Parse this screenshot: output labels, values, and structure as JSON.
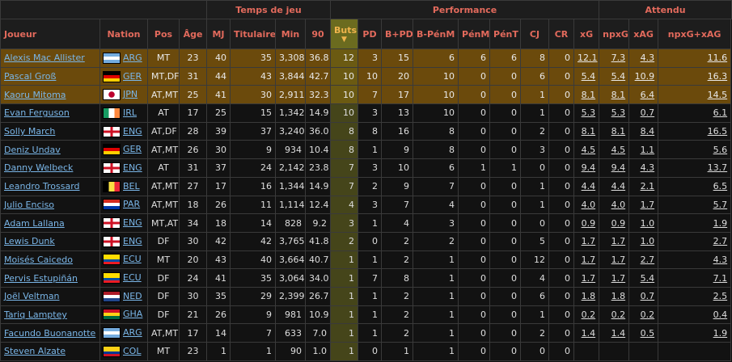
{
  "header": {
    "groups": {
      "playing_time": "Temps de jeu",
      "performance": "Performance",
      "expected": "Attendu"
    },
    "columns": {
      "player": "Joueur",
      "nation": "Nation",
      "pos": "Pos",
      "age": "Âge",
      "mp": "MJ",
      "starts": "Titulaire",
      "min": "Min",
      "nineties": "90",
      "goals": "Buts",
      "sort_arrow": "▼",
      "assists": "PD",
      "ga": "B+PD",
      "gpk": "B-PénM",
      "pk": "PénM",
      "pkatt": "PénT",
      "crdy": "CJ",
      "crdr": "CR",
      "xg": "xG",
      "npxg": "npxG",
      "xag": "xAG",
      "npxgxag": "npxG+xAG"
    }
  },
  "colors": {
    "highlight_row": "#6b4a0c",
    "sorted_column": "#45451a",
    "header_text": "#e26a5c",
    "link": "#7ab6e8"
  },
  "rows": [
    {
      "player": "Alexis Mac Allister",
      "flag": "ARG",
      "nation": "ARG",
      "pos": "MT",
      "age": "23",
      "mp": "40",
      "starts": "35",
      "min": "3,308",
      "nineties": "36.8",
      "goals": "12",
      "assists": "3",
      "ga": "15",
      "gpk": "6",
      "pk": "6",
      "pkatt": "6",
      "crdy": "8",
      "crdr": "0",
      "xg": "12.1",
      "npxg": "7.3",
      "xag": "4.3",
      "npxgxag": "11.6",
      "highlight": true
    },
    {
      "player": "Pascal Groß",
      "flag": "GER",
      "nation": "GER",
      "pos": "MT,DF",
      "age": "31",
      "mp": "44",
      "starts": "43",
      "min": "3,844",
      "nineties": "42.7",
      "goals": "10",
      "assists": "10",
      "ga": "20",
      "gpk": "10",
      "pk": "0",
      "pkatt": "0",
      "crdy": "6",
      "crdr": "0",
      "xg": "5.4",
      "npxg": "5.4",
      "xag": "10.9",
      "npxgxag": "16.3",
      "highlight": true
    },
    {
      "player": "Kaoru Mitoma",
      "flag": "JPN",
      "nation": "JPN",
      "pos": "AT,MT",
      "age": "25",
      "mp": "41",
      "starts": "30",
      "min": "2,911",
      "nineties": "32.3",
      "goals": "10",
      "assists": "7",
      "ga": "17",
      "gpk": "10",
      "pk": "0",
      "pkatt": "0",
      "crdy": "1",
      "crdr": "0",
      "xg": "8.1",
      "npxg": "8.1",
      "xag": "6.4",
      "npxgxag": "14.5",
      "highlight": true
    },
    {
      "player": "Evan Ferguson",
      "flag": "IRL",
      "nation": "IRL",
      "pos": "AT",
      "age": "17",
      "mp": "25",
      "starts": "15",
      "min": "1,342",
      "nineties": "14.9",
      "goals": "10",
      "assists": "3",
      "ga": "13",
      "gpk": "10",
      "pk": "0",
      "pkatt": "0",
      "crdy": "1",
      "crdr": "0",
      "xg": "5.3",
      "npxg": "5.3",
      "xag": "0.7",
      "npxgxag": "6.1",
      "highlight": false
    },
    {
      "player": "Solly March",
      "flag": "ENG",
      "nation": "ENG",
      "pos": "AT,DF",
      "age": "28",
      "mp": "39",
      "starts": "37",
      "min": "3,240",
      "nineties": "36.0",
      "goals": "8",
      "assists": "8",
      "ga": "16",
      "gpk": "8",
      "pk": "0",
      "pkatt": "0",
      "crdy": "2",
      "crdr": "0",
      "xg": "8.1",
      "npxg": "8.1",
      "xag": "8.4",
      "npxgxag": "16.5",
      "highlight": false
    },
    {
      "player": "Deniz Undav",
      "flag": "GER",
      "nation": "GER",
      "pos": "AT,MT",
      "age": "26",
      "mp": "30",
      "starts": "9",
      "min": "934",
      "nineties": "10.4",
      "goals": "8",
      "assists": "1",
      "ga": "9",
      "gpk": "8",
      "pk": "0",
      "pkatt": "0",
      "crdy": "3",
      "crdr": "0",
      "xg": "4.5",
      "npxg": "4.5",
      "xag": "1.1",
      "npxgxag": "5.6",
      "highlight": false
    },
    {
      "player": "Danny Welbeck",
      "flag": "ENG",
      "nation": "ENG",
      "pos": "AT",
      "age": "31",
      "mp": "37",
      "starts": "24",
      "min": "2,142",
      "nineties": "23.8",
      "goals": "7",
      "assists": "3",
      "ga": "10",
      "gpk": "6",
      "pk": "1",
      "pkatt": "1",
      "crdy": "0",
      "crdr": "0",
      "xg": "9.4",
      "npxg": "9.4",
      "xag": "4.3",
      "npxgxag": "13.7",
      "highlight": false
    },
    {
      "player": "Leandro Trossard",
      "flag": "BEL",
      "nation": "BEL",
      "pos": "AT,MT",
      "age": "27",
      "mp": "17",
      "starts": "16",
      "min": "1,344",
      "nineties": "14.9",
      "goals": "7",
      "assists": "2",
      "ga": "9",
      "gpk": "7",
      "pk": "0",
      "pkatt": "0",
      "crdy": "1",
      "crdr": "0",
      "xg": "4.4",
      "npxg": "4.4",
      "xag": "2.1",
      "npxgxag": "6.5",
      "highlight": false
    },
    {
      "player": "Julio Enciso",
      "flag": "PAR",
      "nation": "PAR",
      "pos": "AT,MT",
      "age": "18",
      "mp": "26",
      "starts": "11",
      "min": "1,114",
      "nineties": "12.4",
      "goals": "4",
      "assists": "3",
      "ga": "7",
      "gpk": "4",
      "pk": "0",
      "pkatt": "0",
      "crdy": "1",
      "crdr": "0",
      "xg": "4.0",
      "npxg": "4.0",
      "xag": "1.7",
      "npxgxag": "5.7",
      "highlight": false
    },
    {
      "player": "Adam Lallana",
      "flag": "ENG",
      "nation": "ENG",
      "pos": "MT,AT",
      "age": "34",
      "mp": "18",
      "starts": "14",
      "min": "828",
      "nineties": "9.2",
      "goals": "3",
      "assists": "1",
      "ga": "4",
      "gpk": "3",
      "pk": "0",
      "pkatt": "0",
      "crdy": "0",
      "crdr": "0",
      "xg": "0.9",
      "npxg": "0.9",
      "xag": "1.0",
      "npxgxag": "1.9",
      "highlight": false
    },
    {
      "player": "Lewis Dunk",
      "flag": "ENG",
      "nation": "ENG",
      "pos": "DF",
      "age": "30",
      "mp": "42",
      "starts": "42",
      "min": "3,765",
      "nineties": "41.8",
      "goals": "2",
      "assists": "0",
      "ga": "2",
      "gpk": "2",
      "pk": "0",
      "pkatt": "0",
      "crdy": "5",
      "crdr": "0",
      "xg": "1.7",
      "npxg": "1.7",
      "xag": "1.0",
      "npxgxag": "2.7",
      "highlight": false
    },
    {
      "player": "Moisés Caicedo",
      "flag": "ECU",
      "nation": "ECU",
      "pos": "MT",
      "age": "20",
      "mp": "43",
      "starts": "40",
      "min": "3,664",
      "nineties": "40.7",
      "goals": "1",
      "assists": "1",
      "ga": "2",
      "gpk": "1",
      "pk": "0",
      "pkatt": "0",
      "crdy": "12",
      "crdr": "0",
      "xg": "1.7",
      "npxg": "1.7",
      "xag": "2.7",
      "npxgxag": "4.3",
      "highlight": false
    },
    {
      "player": "Pervis Estupiñán",
      "flag": "ECU",
      "nation": "ECU",
      "pos": "DF",
      "age": "24",
      "mp": "41",
      "starts": "35",
      "min": "3,064",
      "nineties": "34.0",
      "goals": "1",
      "assists": "7",
      "ga": "8",
      "gpk": "1",
      "pk": "0",
      "pkatt": "0",
      "crdy": "4",
      "crdr": "0",
      "xg": "1.7",
      "npxg": "1.7",
      "xag": "5.4",
      "npxgxag": "7.1",
      "highlight": false
    },
    {
      "player": "Joël Veltman",
      "flag": "NED",
      "nation": "NED",
      "pos": "DF",
      "age": "30",
      "mp": "35",
      "starts": "29",
      "min": "2,399",
      "nineties": "26.7",
      "goals": "1",
      "assists": "1",
      "ga": "2",
      "gpk": "1",
      "pk": "0",
      "pkatt": "0",
      "crdy": "6",
      "crdr": "0",
      "xg": "1.8",
      "npxg": "1.8",
      "xag": "0.7",
      "npxgxag": "2.5",
      "highlight": false
    },
    {
      "player": "Tariq Lamptey",
      "flag": "GHA",
      "nation": "GHA",
      "pos": "DF",
      "age": "21",
      "mp": "26",
      "starts": "9",
      "min": "981",
      "nineties": "10.9",
      "goals": "1",
      "assists": "1",
      "ga": "2",
      "gpk": "1",
      "pk": "0",
      "pkatt": "0",
      "crdy": "1",
      "crdr": "0",
      "xg": "0.2",
      "npxg": "0.2",
      "xag": "0.2",
      "npxgxag": "0.4",
      "highlight": false
    },
    {
      "player": "Facundo Buonanotte",
      "flag": "ARG",
      "nation": "ARG",
      "pos": "AT,MT",
      "age": "17",
      "mp": "14",
      "starts": "7",
      "min": "633",
      "nineties": "7.0",
      "goals": "1",
      "assists": "1",
      "ga": "2",
      "gpk": "1",
      "pk": "0",
      "pkatt": "0",
      "crdy": "2",
      "crdr": "0",
      "xg": "1.4",
      "npxg": "1.4",
      "xag": "0.5",
      "npxgxag": "1.9",
      "highlight": false
    },
    {
      "player": "Steven Alzate",
      "flag": "COL",
      "nation": "COL",
      "pos": "MT",
      "age": "23",
      "mp": "1",
      "starts": "1",
      "min": "90",
      "nineties": "1.0",
      "goals": "1",
      "assists": "0",
      "ga": "1",
      "gpk": "1",
      "pk": "0",
      "pkatt": "0",
      "crdy": "0",
      "crdr": "0",
      "xg": "",
      "npxg": "",
      "xag": "",
      "npxgxag": "",
      "highlight": false
    }
  ]
}
